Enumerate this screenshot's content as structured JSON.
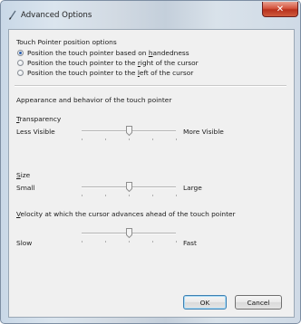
{
  "window": {
    "title": "Advanced Options",
    "close_glyph": "✕"
  },
  "pointer_position": {
    "heading": "Touch Pointer position options",
    "options": [
      {
        "label_pre": "Position the touch pointer based on ",
        "label_key": "h",
        "label_post": "andedness",
        "selected": true
      },
      {
        "label_pre": "Position the touch pointer to the ",
        "label_key": "r",
        "label_post": "ight of the cursor",
        "selected": false
      },
      {
        "label_pre": "Position the touch pointer to the ",
        "label_key": "l",
        "label_post": "eft of the cursor",
        "selected": false
      }
    ]
  },
  "appearance": {
    "heading": "Appearance and behavior of the touch pointer",
    "transparency": {
      "label_key": "T",
      "label_rest": "ransparency",
      "min_label": "Less Visible",
      "max_label": "More Visible",
      "level": 0.5
    },
    "size": {
      "label_key": "S",
      "label_rest": "ize",
      "min_label": "Small",
      "max_label": "Large",
      "level": 0.5
    },
    "velocity": {
      "label_key": "V",
      "label_rest": "elocity at which the cursor advances ahead of the touch pointer",
      "min_label": "Slow",
      "max_label": "Fast",
      "level": 0.5
    }
  },
  "buttons": {
    "ok": "OK",
    "cancel": "Cancel"
  },
  "colors": {
    "accent": "#2a5fb0",
    "close": "#c4412a"
  }
}
